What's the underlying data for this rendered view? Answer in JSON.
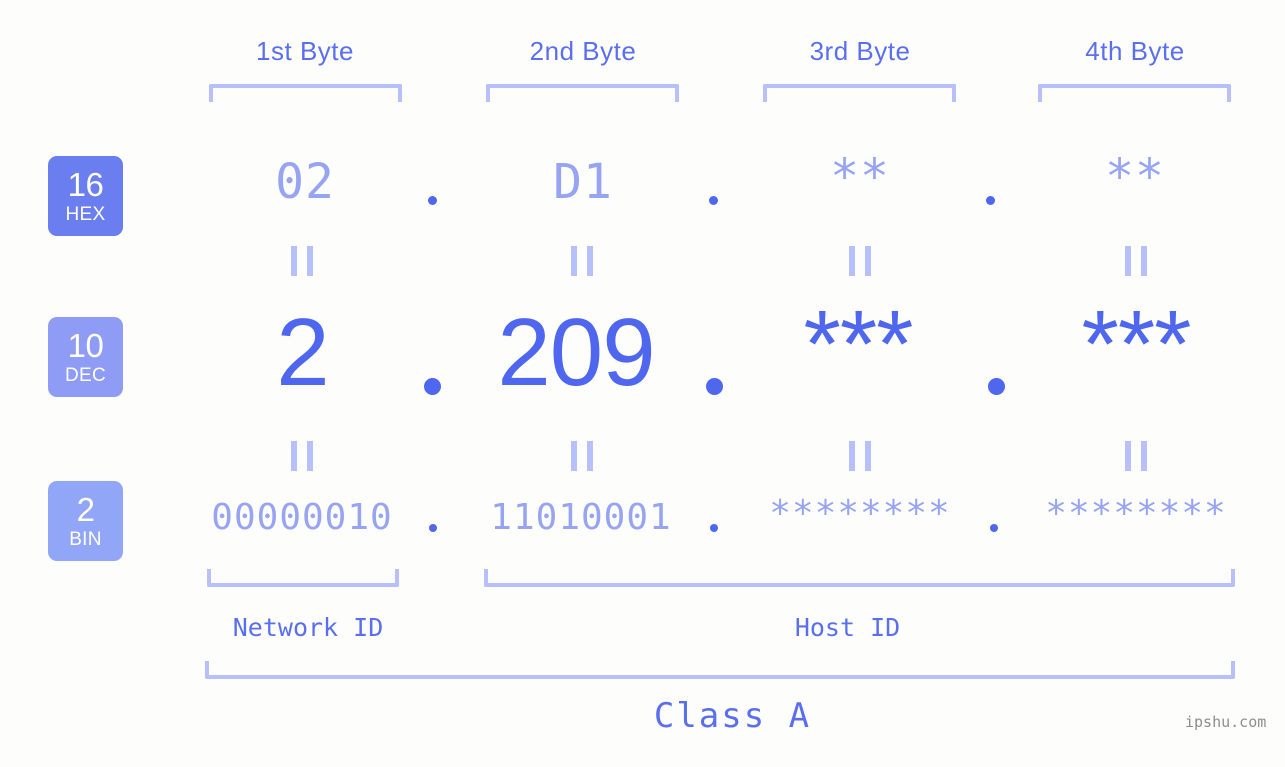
{
  "bases": [
    {
      "num": "16",
      "name": "HEX",
      "color": "#6b7ef0"
    },
    {
      "num": "10",
      "name": "DEC",
      "color": "#8e9cf5"
    },
    {
      "num": "2",
      "name": "BIN",
      "color": "#92a6f7"
    }
  ],
  "byte_headers": [
    {
      "label": "1st Byte"
    },
    {
      "label": "2nd Byte"
    },
    {
      "label": "3rd Byte"
    },
    {
      "label": "4th Byte"
    }
  ],
  "rows": {
    "hex": {
      "values": [
        "02",
        "D1",
        "**",
        "**"
      ]
    },
    "dec": {
      "values": [
        "2",
        "209",
        "***",
        "***"
      ]
    },
    "bin": {
      "values": [
        "00000010",
        "11010001",
        "********",
        "********"
      ]
    }
  },
  "separator": ".",
  "equals_symbol": "=",
  "id_sections": [
    {
      "label": "Network ID"
    },
    {
      "label": "Host ID"
    }
  ],
  "class_label": "Class A",
  "watermark": "ipshu.com",
  "colors": {
    "background": "#fdfefb",
    "accent_strong": "#4f66ee",
    "accent_mid": "#5a6ff0",
    "accent_light": "#97a4f3",
    "bracket": "#b7c0fb",
    "watermark": "#8d8d8d"
  }
}
